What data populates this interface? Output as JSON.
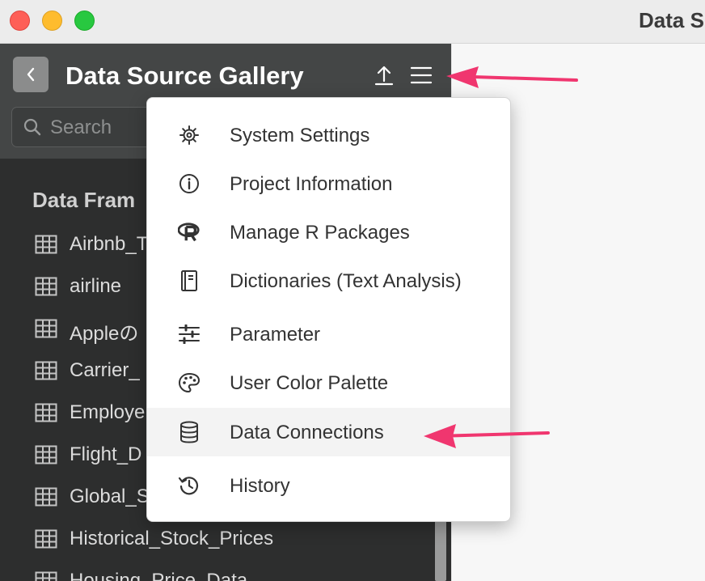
{
  "window": {
    "title": "Data S"
  },
  "panel": {
    "title": "Data Source Gallery",
    "search_placeholder": "Search",
    "section_title": "Data Fram",
    "items": [
      {
        "label": "Airbnb_T"
      },
      {
        "label": "airline"
      },
      {
        "label": "Appleの"
      },
      {
        "label": "Carrier_"
      },
      {
        "label": "Employe"
      },
      {
        "label": "Flight_D"
      },
      {
        "label": "Global_S"
      },
      {
        "label": "Historical_Stock_Prices"
      },
      {
        "label": "Housing_Price_Data"
      }
    ]
  },
  "menu": {
    "items": [
      {
        "label": "System Settings",
        "icon": "gear-icon"
      },
      {
        "label": "Project Information",
        "icon": "info-icon"
      },
      {
        "label": "Manage R Packages",
        "icon": "r-logo-icon"
      },
      {
        "label": "Dictionaries (Text Analysis)",
        "icon": "book-icon"
      },
      {
        "label": "Parameter",
        "icon": "sliders-icon"
      },
      {
        "label": "User Color Palette",
        "icon": "palette-icon"
      },
      {
        "label": "Data Connections",
        "icon": "database-icon"
      },
      {
        "label": "History",
        "icon": "history-icon"
      }
    ],
    "highlighted": "Data Connections"
  },
  "colors": {
    "annotation_arrow": "#f0366f",
    "panel_bg": "#2d2e2e",
    "panel_header_bg": "#444646",
    "menu_highlight": "#f3f3f3"
  }
}
